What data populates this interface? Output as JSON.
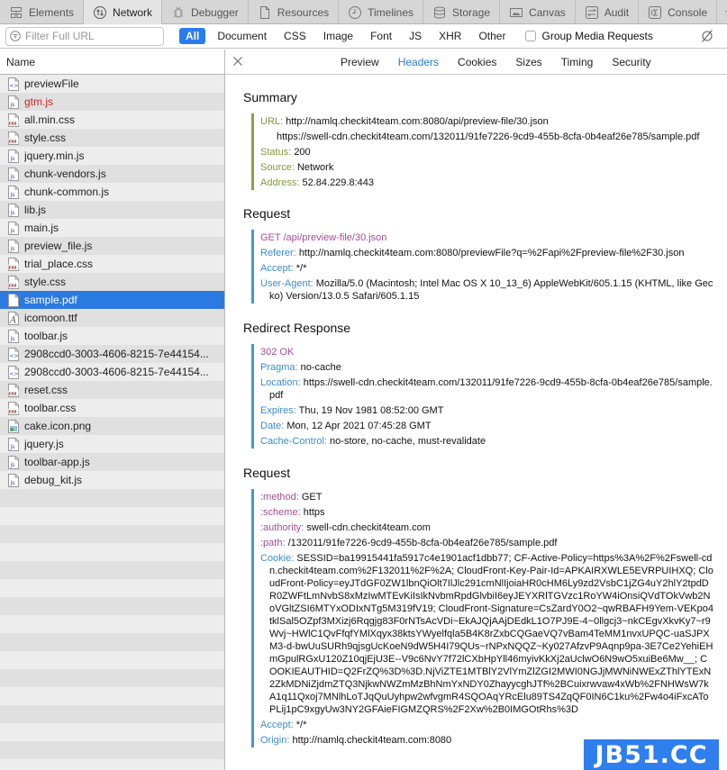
{
  "toolbar": {
    "tabs": [
      {
        "label": "Elements",
        "icon": "elements-icon"
      },
      {
        "label": "Network",
        "icon": "network-icon",
        "active": true
      },
      {
        "label": "Debugger",
        "icon": "debugger-icon"
      },
      {
        "label": "Resources",
        "icon": "resources-icon"
      },
      {
        "label": "Timelines",
        "icon": "timelines-icon"
      },
      {
        "label": "Storage",
        "icon": "storage-icon"
      },
      {
        "label": "Canvas",
        "icon": "canvas-icon"
      },
      {
        "label": "Audit",
        "icon": "audit-icon"
      },
      {
        "label": "Console",
        "icon": "console-icon"
      }
    ],
    "add_label": "+"
  },
  "filter": {
    "placeholder": "Filter Full URL",
    "value": "",
    "types": [
      "All",
      "Document",
      "CSS",
      "Image",
      "Font",
      "JS",
      "XHR",
      "Other"
    ],
    "active_type": "All",
    "group_media_label": "Group Media Requests",
    "group_media_checked": false
  },
  "list": {
    "header": "Name",
    "items": [
      {
        "name": "previewFile",
        "type": "document"
      },
      {
        "name": "gtm.js",
        "type": "js",
        "error": true
      },
      {
        "name": "all.min.css",
        "type": "css"
      },
      {
        "name": "style.css",
        "type": "css"
      },
      {
        "name": "jquery.min.js",
        "type": "js"
      },
      {
        "name": "chunk-vendors.js",
        "type": "js"
      },
      {
        "name": "chunk-common.js",
        "type": "js"
      },
      {
        "name": "lib.js",
        "type": "js"
      },
      {
        "name": "main.js",
        "type": "js"
      },
      {
        "name": "preview_file.js",
        "type": "js"
      },
      {
        "name": "trial_place.css",
        "type": "css"
      },
      {
        "name": "style.css",
        "type": "css"
      },
      {
        "name": "sample.pdf",
        "type": "other",
        "selected": true
      },
      {
        "name": "icomoon.ttf",
        "type": "font"
      },
      {
        "name": "toolbar.js",
        "type": "js"
      },
      {
        "name": "2908ccd0-3003-4606-8215-7e44154...",
        "type": "document"
      },
      {
        "name": "2908ccd0-3003-4606-8215-7e44154...",
        "type": "document"
      },
      {
        "name": "reset.css",
        "type": "css"
      },
      {
        "name": "toolbar.css",
        "type": "css"
      },
      {
        "name": "cake.icon.png",
        "type": "image"
      },
      {
        "name": "jquery.js",
        "type": "js"
      },
      {
        "name": "toolbar-app.js",
        "type": "js"
      },
      {
        "name": "debug_kit.js",
        "type": "js"
      }
    ]
  },
  "detail": {
    "tabs": [
      "Preview",
      "Headers",
      "Cookies",
      "Sizes",
      "Timing",
      "Security"
    ],
    "active_tab": "Headers",
    "summary": {
      "title": "Summary",
      "url_label": "URL:",
      "url": "http://namlq.checkit4team.com:8080/api/preview-file/30.json",
      "redirect_url": "https://swell-cdn.checkit4team.com/132011/91fe7226-9cd9-455b-8cfa-0b4eaf26e785/sample.pdf",
      "status_label": "Status:",
      "status": "200",
      "source_label": "Source:",
      "source": "Network",
      "address_label": "Address:",
      "address": "52.84.229.8:443"
    },
    "request": {
      "title": "Request",
      "request_line": "GET /api/preview-file/30.json",
      "headers": [
        {
          "name": "Referer:",
          "value": "http://namlq.checkit4team.com:8080/previewFile?q=%2Fapi%2Fpreview-file%2F30.json"
        },
        {
          "name": "Accept:",
          "value": "*/*"
        },
        {
          "name": "User-Agent:",
          "value": "Mozilla/5.0 (Macintosh; Intel Mac OS X 10_13_6) AppleWebKit/605.1.15 (KHTML, like Gecko) Version/13.0.5 Safari/605.1.15"
        }
      ]
    },
    "redirect_response": {
      "title": "Redirect Response",
      "status_line": "302 OK",
      "headers": [
        {
          "name": "Pragma:",
          "value": "no-cache"
        },
        {
          "name": "Location:",
          "value": "https://swell-cdn.checkit4team.com/132011/91fe7226-9cd9-455b-8cfa-0b4eaf26e785/sample.pdf"
        },
        {
          "name": "Expires:",
          "value": "Thu, 19 Nov 1981 08:52:00 GMT"
        },
        {
          "name": "Date:",
          "value": "Mon, 12 Apr 2021 07:45:28 GMT"
        },
        {
          "name": "Cache-Control:",
          "value": "no-store, no-cache, must-revalidate"
        }
      ]
    },
    "request2": {
      "title": "Request",
      "pseudo_headers": [
        {
          "name": ":method:",
          "value": "GET"
        },
        {
          "name": ":scheme:",
          "value": "https"
        },
        {
          "name": ":authority:",
          "value": "swell-cdn.checkit4team.com"
        },
        {
          "name": ":path:",
          "value": "/132011/91fe7226-9cd9-455b-8cfa-0b4eaf26e785/sample.pdf"
        }
      ],
      "headers": [
        {
          "name": "Cookie:",
          "value": "SESSID=ba19915441fa5917c4e1901acf1dbb77; CF-Active-Policy=https%3A%2F%2Fswell-cdn.checkit4team.com%2F132011%2F%2A; CloudFront-Key-Pair-Id=APKAIRXWLE5EVRPUIHXQ; CloudFront-Policy=eyJTdGF0ZW1lbnQiOlt7IlJlc291cmNlIjoiaHR0cHM6Ly9zd2VsbC1jZG4uY2hlY2tpdDR0ZWFtLmNvbS8xMzIwMTEvKiIsIkNvbmRpdGlvbiI6eyJEYXRlTGVzc1RoYW4iOnsiQVdTOkVwb2NoVGltZSI6MTYxODIxNTg5M319fV19; CloudFront-Signature=CsZardY0O2~qwRBAFH9Yem-VEKpo4tklSal5OZpf3MXizj6Rqgjg83F0rNTsAcVDi~EkAJQjAAjDEdkL1O7PJ9E-4~0llgcj3~nkCEgvXkvKy7~r9Wvj~HWlC1QvFfqfYMlXqyx38ktsYWyelfqla5B4K8rZxbCQGaeVQ7vBam4TeMM1nvxUPQC-uaSJPXM3-d-bwUuSURh9qjsgUcKoeN9dW5H4I79QUs~rNPxNQQZ~Ky027AfzvP9Aqnp9pa-3E7Ce2YehiEHmGpulRGxU120Z10qjEjU3E--V9c6NvY7f72lCXbHpYll46myivKkXj2aUclwO6N9wO5xuiBe6Mw__; COOKIEAUTHID=Q2FrZQ%3D%3D.NjViZTE1MTBlY2VlYmZlZGI2MWI0NGJjMWNiNWExZThlYTExN2ZkMDNiZjdmZTQ3NjkwNWZmMzBhNmYxNDY0ZhayycghJTf%2BCuixrwvaw4xWb%2FNHWsW7kA1q11Qxoj7MNlhLoTJqQuUyhpw2wfvgmR4SQOAqYRcElu89TS4ZqQF0IN6C1ku%2Fw4o4iFxcAToPLij1pC9xgyUw3NY2GFAieFIGMZQRS%2F2Xw%2B0IMGOtRhs%3D"
        },
        {
          "name": "Accept:",
          "value": "*/*"
        },
        {
          "name": "Origin:",
          "value": "http://namlq.checkit4team.com:8080"
        }
      ]
    }
  },
  "watermark": "JB51.CC"
}
